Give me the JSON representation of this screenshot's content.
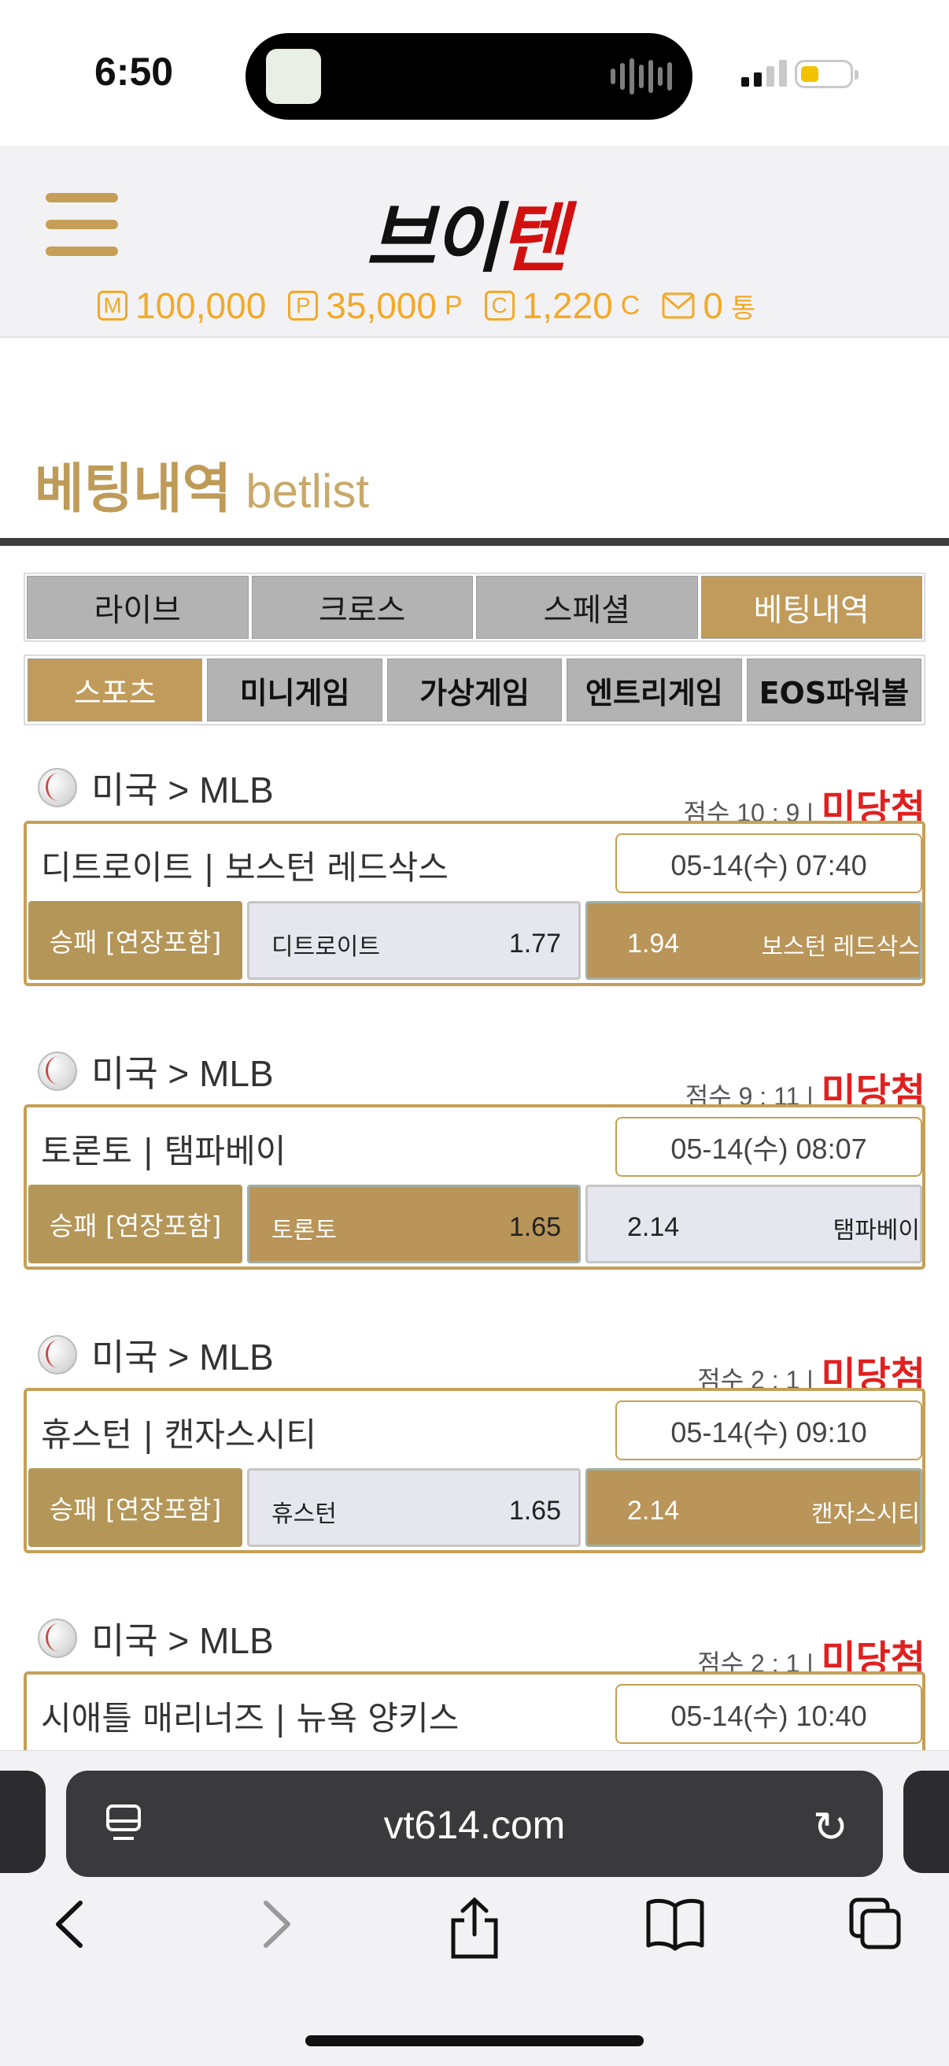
{
  "status_bar": {
    "time": "6:50"
  },
  "header": {
    "logo_part1": "브이",
    "logo_part2": "텐",
    "balances": [
      {
        "icon": "M",
        "value": "100,000",
        "unit": ""
      },
      {
        "icon": "P",
        "value": "35,000",
        "unit": "P"
      },
      {
        "icon": "C",
        "value": "1,220",
        "unit": "C"
      },
      {
        "icon": "mail-icon",
        "value": "0",
        "unit": "통"
      }
    ]
  },
  "page": {
    "title_ko": "베팅내역",
    "title_en": "betlist"
  },
  "tabs_main": [
    "라이브",
    "크로스",
    "스페셜",
    "베팅내역"
  ],
  "tabs_sub": [
    "스포츠",
    "미니게임",
    "가상게임",
    "엔트리게임",
    "EOS파워볼"
  ],
  "bets": [
    {
      "league": "미국 > MLB",
      "score": "점수 10 : 9 |",
      "result": "미당첨",
      "teams": "디트로이트 | 보스턴 레드삭스",
      "datetime": "05-14(수) 07:40",
      "bet_type": "승패 [연장포함]",
      "home": "디트로이트",
      "home_odds": "1.77",
      "away": "보스턴 레드삭스",
      "away_odds": "1.94",
      "selected": "away"
    },
    {
      "league": "미국 > MLB",
      "score": "점수 9 : 11 |",
      "result": "미당첨",
      "teams": "토론토 | 탬파베이",
      "datetime": "05-14(수) 08:07",
      "bet_type": "승패 [연장포함]",
      "home": "토론토",
      "home_odds": "1.65",
      "away": "탬파베이",
      "away_odds": "2.14",
      "selected": "home"
    },
    {
      "league": "미국 > MLB",
      "score": "점수 2 : 1 |",
      "result": "미당첨",
      "teams": "휴스턴 | 캔자스시티",
      "datetime": "05-14(수) 09:10",
      "bet_type": "승패 [연장포함]",
      "home": "휴스턴",
      "home_odds": "1.65",
      "away": "캔자스시티",
      "away_odds": "2.14",
      "selected": "away"
    },
    {
      "league": "미국 > MLB",
      "score": "점수 2 : 1 |",
      "result": "미당첨",
      "teams": "시애틀 매리너즈 | 뉴욕 양키스",
      "datetime": "05-14(수) 10:40"
    }
  ],
  "browser": {
    "url": "vt614.com"
  },
  "colors": {
    "gold": "#c59f57",
    "lost": "#e12020",
    "balance": "#f3a928"
  }
}
